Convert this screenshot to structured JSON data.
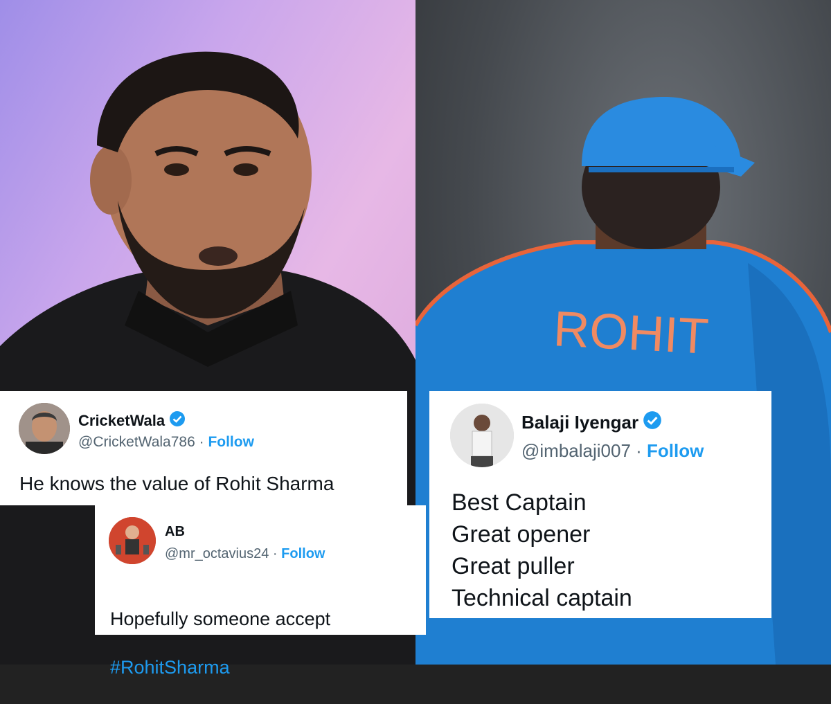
{
  "photos": {
    "left": {
      "subject": "man with beard in black shirt"
    },
    "right": {
      "subject": "cricketer in blue jersey and cap",
      "jersey_text": "ROHIT"
    }
  },
  "tweets": [
    {
      "name": "CricketWala",
      "verified": true,
      "handle": "@CricketWala786",
      "separator": " · ",
      "follow": "Follow",
      "text": "He knows the value of Rohit Sharma"
    },
    {
      "name": "AB",
      "verified": false,
      "handle": "@mr_octavius24",
      "separator": " · ",
      "follow": "Follow",
      "text": "Hopefully someone accept",
      "hashtag": "#RohitSharma"
    },
    {
      "name": "Balaji Iyengar",
      "verified": true,
      "handle": "@imbalaji007",
      "separator": " · ",
      "follow": "Follow",
      "text": "Best Captain\nGreat opener\nGreat  puller\nTechnical captain"
    }
  ],
  "colors": {
    "link": "#1d9bf0",
    "text": "#0f1419",
    "muted": "#536471",
    "jersey": "#1f7fd1"
  }
}
